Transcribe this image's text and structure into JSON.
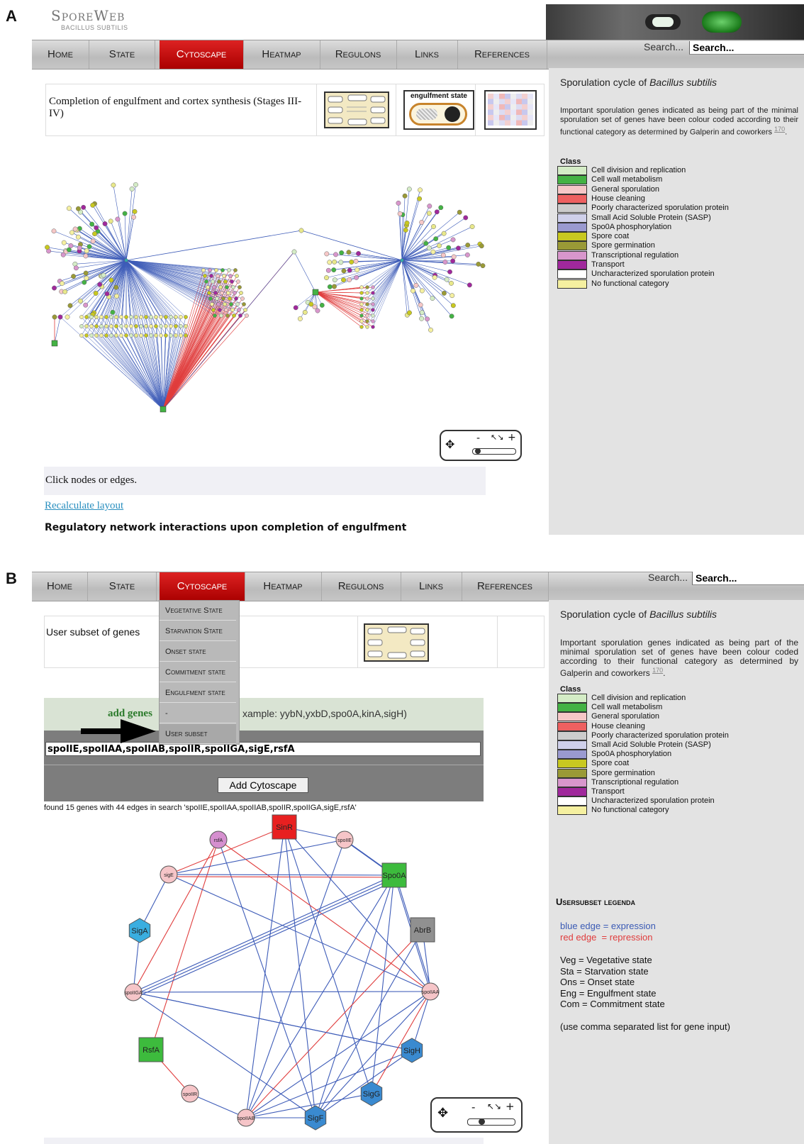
{
  "panel_a": {
    "letter": "A",
    "brand": {
      "title": "SporeWeb",
      "subtitle": "BACILLUS SUBTILIS"
    },
    "nav": [
      "Home",
      "State",
      "Cytoscape",
      "Heatmap",
      "Regulons",
      "Links",
      "References"
    ],
    "active_nav": "Cytoscape",
    "search": {
      "label": "Search...",
      "value": "Search..."
    },
    "info_title": "Completion of engulfment and cortex synthesis (Stages III-IV)",
    "thumb_engulfment_label": "engulfment state",
    "status_text": "Click nodes or edges.",
    "recalc_link": "Recalculate layout",
    "caption": "Regulatory network interactions upon completion of engulfment",
    "sidebar": {
      "title_prefix": "Sporulation cycle of ",
      "title_species": "Bacillus subtilis",
      "description": "Important sporulation genes indicated as being part of the minimal sporulation set of genes have been colour coded according to their functional category as determined by Galperin and coworkers",
      "ref": "170",
      "class_label": "Class"
    }
  },
  "panel_b": {
    "letter": "B",
    "nav": [
      "Home",
      "State",
      "Cytoscape",
      "Heatmap",
      "Regulons",
      "Links",
      "References"
    ],
    "active_nav": "Cytoscape",
    "search": {
      "label": "Search...",
      "value": "Search..."
    },
    "dropdown": [
      "Vegetative State",
      "Starvation State",
      "Onset state",
      "Commitment state",
      "Engulfment state",
      "-",
      "User subset"
    ],
    "info_title": "User subset of genes",
    "add_genes_prefix": "add genes",
    "add_genes_example": "xample: yybN,yxbD,spo0A,kinA,sigH)",
    "gene_input_value": "spoIIE,spoIIAA,spoIIAB,spoIIR,spoIIGA,sigE,rsfA",
    "add_button": "Add Cytoscape",
    "found_text": "found 15 genes with 44 edges in search 'spoIIE,spoIIAA,spoIIAB,spoIIR,spoIIGA,sigE,rsfA'",
    "sidebar": {
      "title_prefix": "Sporulation cycle of ",
      "title_species": "Bacillus subtilis",
      "description": "Important sporulation genes indicated as being part of the minimal sporulation set of genes have been colour coded according to their functional category as determined by Galperin and coworkers",
      "ref": "170",
      "class_label": "Class",
      "usersubset_title": "Usersubset legenda",
      "blue_edge": "blue edge = expression",
      "red_edge": "red edge  = repression",
      "abbrev": [
        "Veg = Vegetative state",
        "Sta = Starvation state",
        "Ons = Onset state",
        "Eng = Engulfment state",
        "Com = Commitment state"
      ],
      "note": "(use comma separated list for gene input)"
    },
    "network_nodes": [
      {
        "id": "SinR",
        "shape": "square",
        "color": "#e82020"
      },
      {
        "id": "Spo0A",
        "shape": "square",
        "color": "#3dbb3d"
      },
      {
        "id": "AbrB",
        "shape": "square",
        "color": "#909090"
      },
      {
        "id": "RsfA",
        "shape": "square",
        "color": "#3dbb3d"
      },
      {
        "id": "SigA",
        "shape": "hexagon",
        "color": "#3aaee0"
      },
      {
        "id": "SigH",
        "shape": "hexagon",
        "color": "#3a8ad0"
      },
      {
        "id": "SigG",
        "shape": "hexagon",
        "color": "#3a8ad0"
      },
      {
        "id": "SigF",
        "shape": "hexagon",
        "color": "#3a8ad0"
      },
      {
        "id": "rsfA",
        "shape": "circle",
        "color": "#d58fcf"
      },
      {
        "id": "spoIIE",
        "shape": "circle",
        "color": "#f6c5c8"
      },
      {
        "id": "sigE",
        "shape": "circle",
        "color": "#f6c5c8"
      },
      {
        "id": "spoIIGA",
        "shape": "circle",
        "color": "#f6c5c8"
      },
      {
        "id": "spoIIAA",
        "shape": "circle",
        "color": "#f6c5c8"
      },
      {
        "id": "spoIIR",
        "shape": "circle",
        "color": "#f6c5c8"
      },
      {
        "id": "spoIIAB",
        "shape": "circle",
        "color": "#f6c5c8"
      }
    ]
  },
  "legend": [
    {
      "label": "Cell division and replication",
      "color": "#d4ecc6"
    },
    {
      "label": "Cell wall metabolism",
      "color": "#44b244"
    },
    {
      "label": "General sporulation",
      "color": "#f6c7c7"
    },
    {
      "label": "House cleaning",
      "color": "#ee6060"
    },
    {
      "label": "Poorly characterized sporulation protein",
      "color": "#cccccc"
    },
    {
      "label": "Small Acid Soluble Protein (SASP)",
      "color": "#cfd0ea"
    },
    {
      "label": "Spo0A phosphorylation",
      "color": "#9a9ad0"
    },
    {
      "label": "Spore coat",
      "color": "#c8c820"
    },
    {
      "label": "Spore germination",
      "color": "#9a9a36"
    },
    {
      "label": "Transcriptional regulation",
      "color": "#d896cc"
    },
    {
      "label": "Transport",
      "color": "#a0289c"
    },
    {
      "label": "Uncharacterized sporulation protein",
      "color": "#ffffff"
    },
    {
      "label": "No functional category",
      "color": "#f5f0a0"
    }
  ],
  "zoom_symbols": {
    "minus": "-",
    "plus": "+",
    "fit": "↖↘"
  }
}
